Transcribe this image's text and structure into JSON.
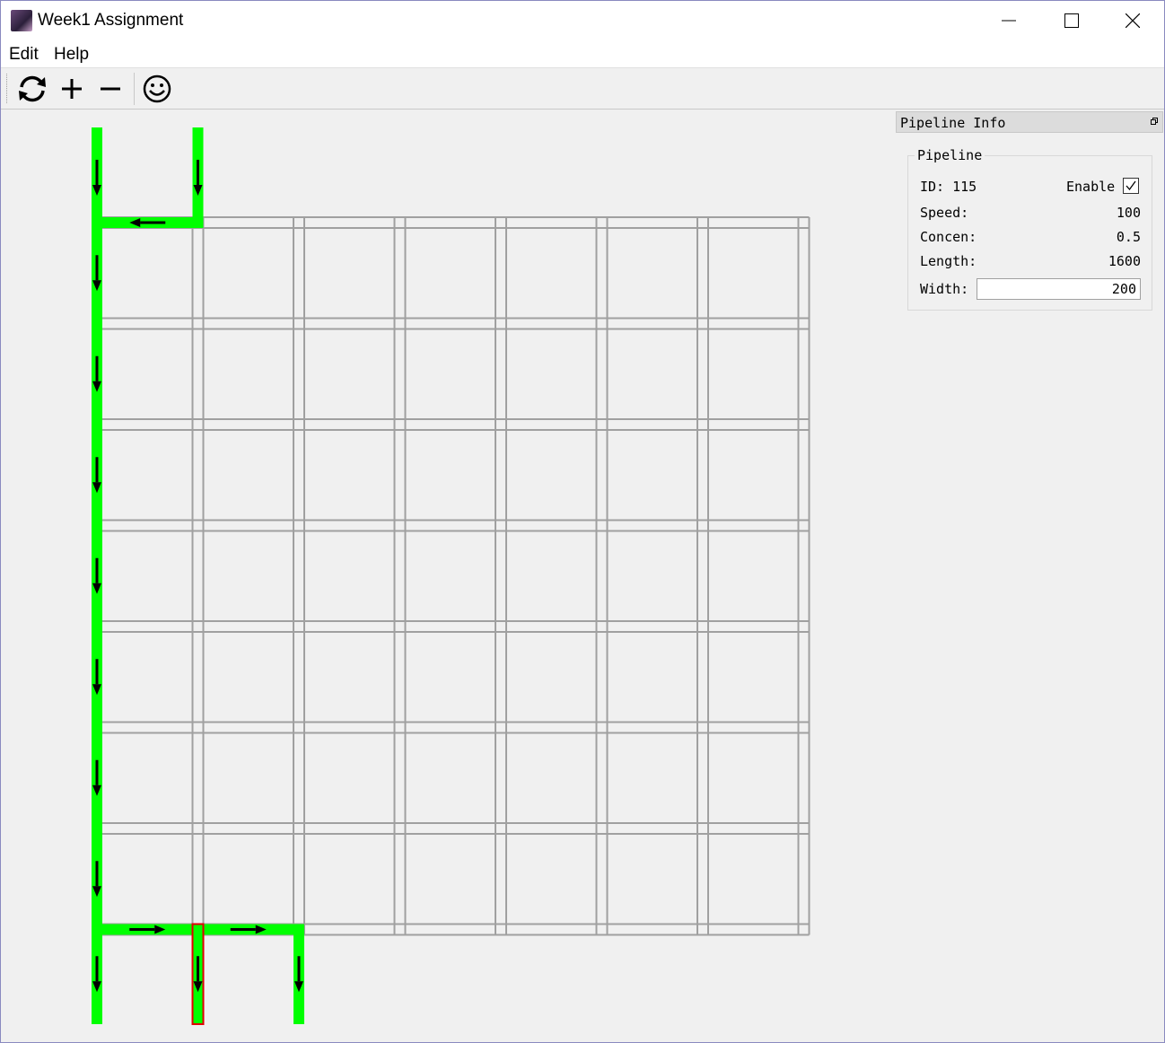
{
  "window": {
    "title": "Week1 Assignment",
    "controls": [
      "minimize",
      "maximize",
      "close"
    ]
  },
  "menu": {
    "items": [
      {
        "label": "Edit"
      },
      {
        "label": "Help"
      }
    ]
  },
  "toolbar": {
    "buttons": [
      {
        "name": "refresh",
        "icon": "refresh-icon"
      },
      {
        "name": "add",
        "icon": "plus-icon"
      },
      {
        "name": "remove",
        "icon": "minus-icon"
      },
      {
        "name": "about",
        "icon": "smiley-icon"
      }
    ]
  },
  "dock": {
    "title": "Pipeline Info",
    "group_title": "Pipeline",
    "id_label": "ID: 115",
    "enable_label": "Enable",
    "enable_checked": true,
    "speed_label": "Speed:",
    "speed_value": "100",
    "concen_label": "Concen:",
    "concen_value": "0.5",
    "length_label": "Length:",
    "length_value": "1600",
    "width_label": "Width:",
    "width_value": "200"
  },
  "grid": {
    "columns": 7,
    "rows": 7,
    "line_color": "#a0a0a0",
    "flow_color": "#00ff00",
    "selected_color": "#e00000",
    "flow_pipes": [
      {
        "id": "inlet-left",
        "col_line": 0,
        "from_row": -1,
        "to_row": 0,
        "dir": "down"
      },
      {
        "id": "inlet-right",
        "col_line": 1,
        "from_row": -1,
        "to_row": 0,
        "dir": "down"
      },
      {
        "id": "top-connector",
        "row_line": 0,
        "from_col": 0,
        "to_col": 1,
        "dir": "left"
      },
      {
        "id": "left-trunk",
        "col_line": 0,
        "from_row": 0,
        "to_row": 7,
        "dir": "down"
      },
      {
        "id": "bottom-connector-1",
        "row_line": 7,
        "from_col": 0,
        "to_col": 1,
        "dir": "right"
      },
      {
        "id": "bottom-connector-2",
        "row_line": 7,
        "from_col": 1,
        "to_col": 2,
        "dir": "right"
      },
      {
        "id": "outlet-1",
        "col_line": 0,
        "from_row": 7,
        "to_row": 8,
        "dir": "down"
      },
      {
        "id": "outlet-2",
        "col_line": 1,
        "from_row": 7,
        "to_row": 8,
        "dir": "down",
        "selected": true
      },
      {
        "id": "outlet-3",
        "col_line": 2,
        "from_row": 7,
        "to_row": 8,
        "dir": "down"
      }
    ]
  }
}
